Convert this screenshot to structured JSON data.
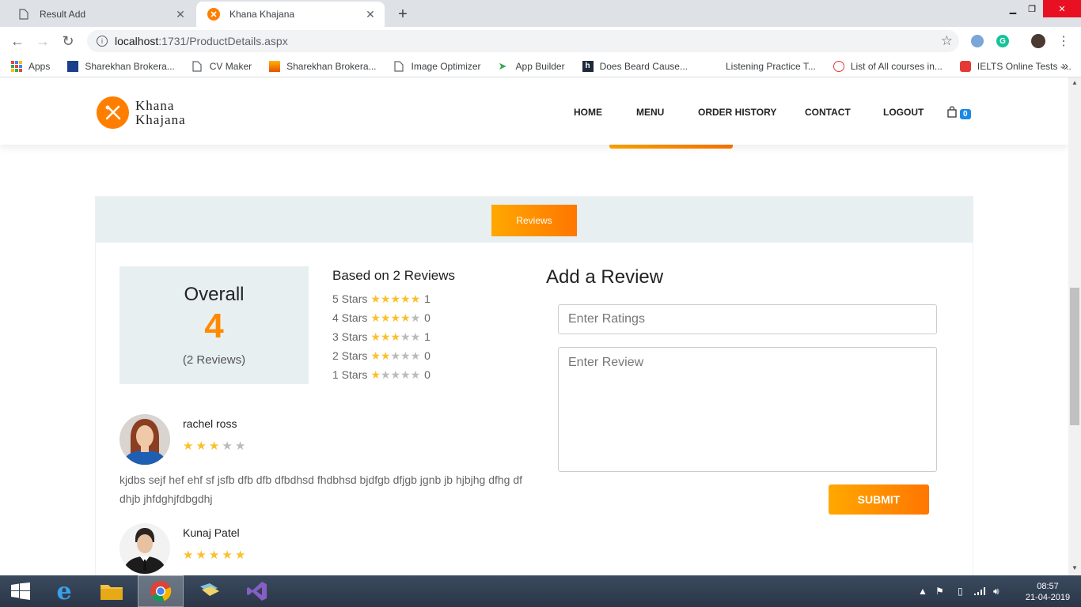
{
  "browser": {
    "tabs": [
      {
        "title": "Result Add",
        "active": false
      },
      {
        "title": "Khana Khajana",
        "active": true
      }
    ],
    "url_host": "localhost",
    "url_path": ":1731/ProductDetails.aspx",
    "bookmarks": [
      "Apps",
      "Sharekhan Brokera...",
      "CV Maker",
      "Sharekhan Brokera...",
      "Image Optimizer",
      "App Builder",
      "Does Beard Cause...",
      "Listening Practice T...",
      "List of All courses in...",
      "IELTS Online Tests -..."
    ],
    "more_bookmarks": "»"
  },
  "site": {
    "logo_line1": "Khana",
    "logo_line2": "Khajana",
    "nav": [
      "HOME",
      "MENU",
      "ORDER HISTORY",
      "CONTACT",
      "LOGOUT"
    ],
    "cart_count": "0"
  },
  "reviews": {
    "tab_label": "Reviews",
    "overall_title": "Overall",
    "overall_value": "4",
    "overall_count": "(2 Reviews)",
    "based_on": "Based on 2 Reviews",
    "breakdown": [
      {
        "label": "5 Stars",
        "stars": 5,
        "count": "1"
      },
      {
        "label": "4 Stars",
        "stars": 4,
        "count": "0"
      },
      {
        "label": "3 Stars",
        "stars": 3,
        "count": "1"
      },
      {
        "label": "2 Stars",
        "stars": 2,
        "count": "0"
      },
      {
        "label": "1 Stars",
        "stars": 1,
        "count": "0"
      }
    ],
    "items": [
      {
        "name": "rachel ross",
        "rating": 3,
        "text": "kjdbs sejf hef ehf sf jsfb dfb dfb dfbdhsd fhdbhsd bjdfgb dfjgb jgnb jb hjbjhg dfhg df dhjb jhfdghjfdbgdhj"
      },
      {
        "name": "Kunaj Patel",
        "rating": 5,
        "text": ""
      }
    ]
  },
  "add_review": {
    "title": "Add a Review",
    "ratings_placeholder": "Enter Ratings",
    "review_placeholder": "Enter Review",
    "submit_label": "SUBMIT"
  },
  "taskbar": {
    "time": "08:57",
    "date": "21-04-2019"
  },
  "colors": {
    "accent": "#ff8a00",
    "star": "#fbc02d",
    "panel": "#e8eff1"
  }
}
